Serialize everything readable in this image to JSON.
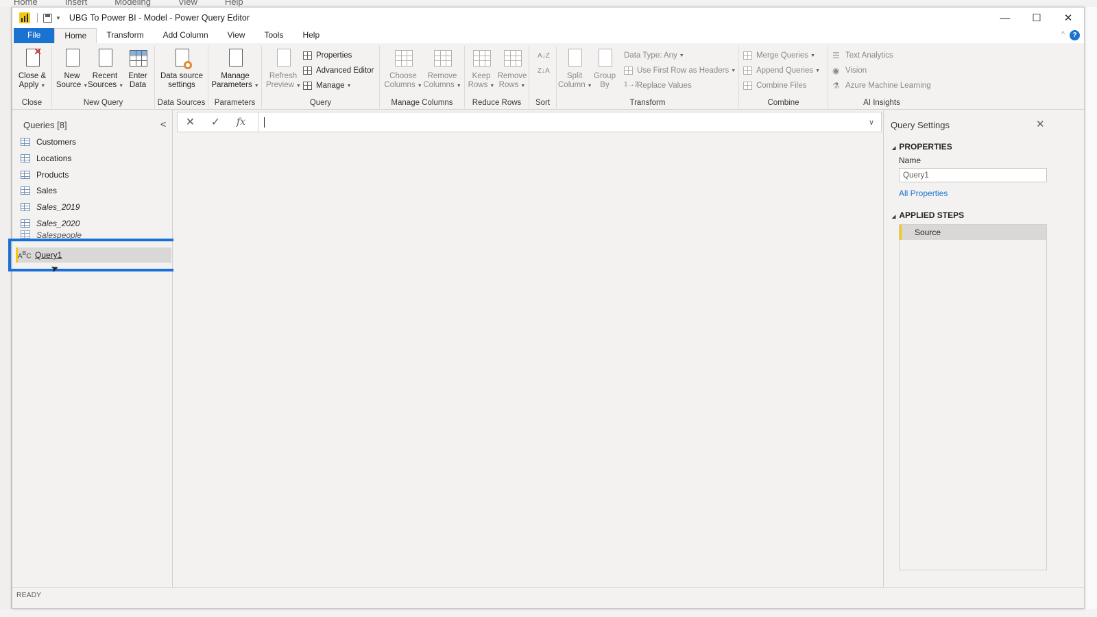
{
  "background_app": {
    "menu": [
      "Home",
      "Insert",
      "Modeling",
      "View",
      "Help"
    ]
  },
  "window": {
    "title": "UBG To Power BI - Model - Power Query Editor",
    "controls": {
      "minimize": "—",
      "maximize": "☐",
      "close": "✕"
    }
  },
  "tabs": [
    {
      "label": "File"
    },
    {
      "label": "Home"
    },
    {
      "label": "Transform"
    },
    {
      "label": "Add Column"
    },
    {
      "label": "View"
    },
    {
      "label": "Tools"
    },
    {
      "label": "Help"
    }
  ],
  "active_tab": "Home",
  "ribbon": {
    "close_group": {
      "label": "Close",
      "close_apply": "Close &\nApply"
    },
    "new_query": {
      "label": "New Query",
      "new_source": "New\nSource",
      "recent_sources": "Recent\nSources",
      "enter_data": "Enter\nData"
    },
    "data_sources": {
      "label": "Data Sources",
      "settings": "Data source\nsettings"
    },
    "parameters": {
      "label": "Parameters",
      "manage": "Manage\nParameters"
    },
    "query": {
      "label": "Query",
      "refresh": "Refresh\nPreview",
      "properties": "Properties",
      "advanced_editor": "Advanced Editor",
      "manage": "Manage"
    },
    "manage_columns": {
      "label": "Manage Columns",
      "choose": "Choose\nColumns",
      "remove": "Remove\nColumns"
    },
    "reduce_rows": {
      "label": "Reduce Rows",
      "keep": "Keep\nRows",
      "remove": "Remove\nRows"
    },
    "sort": {
      "label": "Sort"
    },
    "transform": {
      "label": "Transform",
      "split": "Split\nColumn",
      "group": "Group\nBy",
      "data_type": "Data Type: Any",
      "first_row": "Use First Row as Headers",
      "replace": "Replace Values"
    },
    "combine": {
      "label": "Combine",
      "merge": "Merge Queries",
      "append": "Append Queries",
      "combine_files": "Combine Files"
    },
    "ai": {
      "label": "AI Insights",
      "text_analytics": "Text Analytics",
      "vision": "Vision",
      "azure_ml": "Azure Machine Learning"
    }
  },
  "queries_pane": {
    "title": "Queries [8]",
    "items": [
      {
        "label": "Customers"
      },
      {
        "label": "Locations"
      },
      {
        "label": "Products"
      },
      {
        "label": "Sales"
      },
      {
        "label": "Sales_2019"
      },
      {
        "label": "Sales_2020"
      },
      {
        "label": "Salespeople"
      },
      {
        "label": "Query1"
      }
    ],
    "selected": "Query1"
  },
  "formula_bar": {
    "cancel": "✕",
    "commit": "✓",
    "fx": "fx",
    "value": ""
  },
  "query_settings": {
    "title": "Query Settings",
    "properties_header": "PROPERTIES",
    "name_label": "Name",
    "name_value": "Query1",
    "all_properties_link": "All Properties",
    "applied_steps_header": "APPLIED STEPS",
    "steps": [
      {
        "label": "Source"
      }
    ]
  },
  "status": {
    "text": "READY"
  },
  "colors": {
    "accent_blue": "#1a73d1",
    "highlight_box": "#1a6fd9",
    "selected_marker": "#f2c811"
  }
}
